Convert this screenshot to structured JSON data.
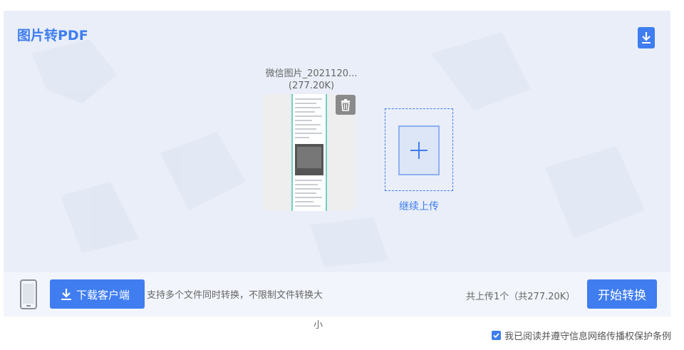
{
  "header": {
    "title": "图片转PDF"
  },
  "file": {
    "name": "微信图片_2021120...",
    "size": "(277.20K)"
  },
  "add_more": {
    "label": "继续上传"
  },
  "bottom": {
    "download_label": "下载客户端",
    "support_text": "支持多个文件同时转换，不限制文件转换大",
    "support_tail": "小",
    "upload_count": "共上传1个（共277.20K）",
    "start_label": "开始转换"
  },
  "agreement": {
    "text": "我已阅读并遵守信息网络传播权保护条例",
    "checked": true
  },
  "colors": {
    "accent": "#3f7df0",
    "panel": "#e9eef8",
    "bar": "#f2f5fb"
  },
  "icons": [
    "download-icon",
    "trash-icon",
    "plus-icon",
    "phone-icon",
    "checkbox-icon"
  ]
}
